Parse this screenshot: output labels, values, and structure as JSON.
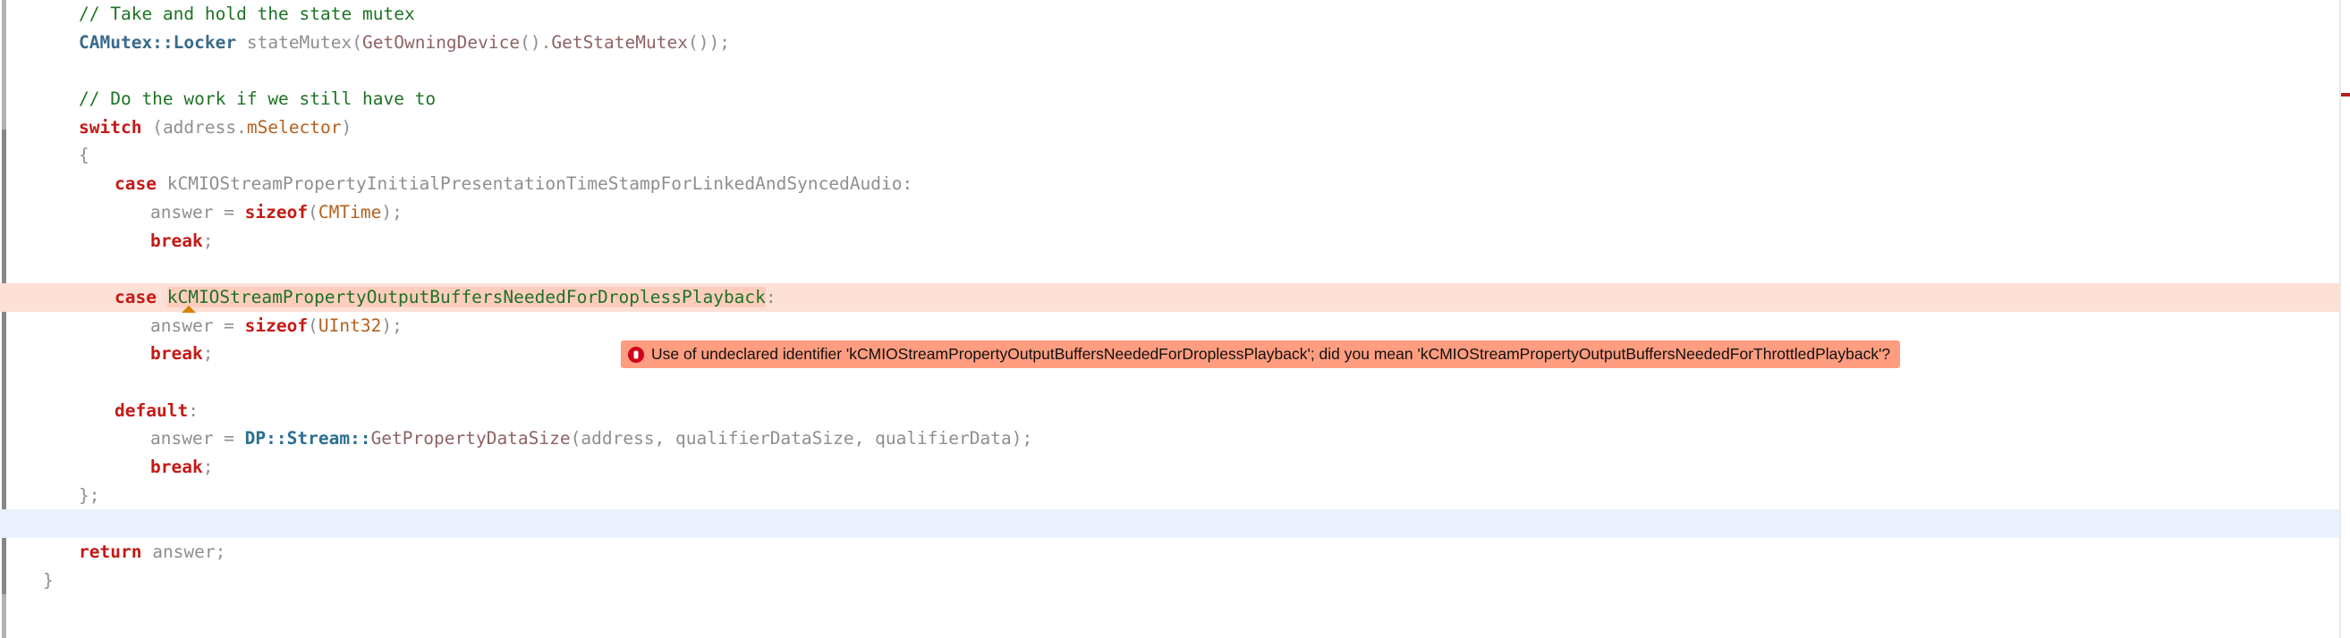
{
  "editor": {
    "language": "C++",
    "colors": {
      "background": "#ffffff",
      "keyword": "#c41a16",
      "comment": "#1d7324",
      "identifier": "#8f8f8f",
      "type": "#3a6a8c",
      "member": "#8e6464",
      "enum_constant": "#b4611f",
      "error_row_background": "#fde0d6",
      "error_token_background": "#ffcdbe",
      "current_line_background": "#eaf1fc",
      "error_bubble_background": "#ff9d80",
      "error_badge": "#d0021b",
      "caret_marker": "#d98000",
      "gutter_bar": "#b3b3b3",
      "gutter_thumb": "#878787",
      "right_rail_mark": "#b31f1f"
    }
  },
  "code": {
    "lines": [
      {
        "id": "line-comment-take-hold",
        "indent": 0,
        "highlight": "none",
        "tokens": [
          {
            "cls": "cmt",
            "text": "// Take and hold the state mutex"
          }
        ]
      },
      {
        "id": "line-camutex-locker",
        "indent": 0,
        "highlight": "none",
        "tokens": [
          {
            "cls": "type",
            "text": "CAMutex::Locker"
          },
          {
            "cls": "plain",
            "text": " "
          },
          {
            "cls": "ident",
            "text": "stateMutex"
          },
          {
            "cls": "punct",
            "text": "("
          },
          {
            "cls": "member",
            "text": "GetOwningDevice"
          },
          {
            "cls": "punct",
            "text": "()."
          },
          {
            "cls": "member",
            "text": "GetStateMutex"
          },
          {
            "cls": "punct",
            "text": "());"
          }
        ]
      },
      {
        "id": "line-blank-1",
        "indent": 0,
        "highlight": "none",
        "tokens": []
      },
      {
        "id": "line-comment-do-work",
        "indent": 0,
        "highlight": "none",
        "tokens": [
          {
            "cls": "cmt",
            "text": "// Do the work if we still have to"
          }
        ]
      },
      {
        "id": "line-switch",
        "indent": 0,
        "highlight": "none",
        "tokens": [
          {
            "cls": "kw",
            "text": "switch"
          },
          {
            "cls": "punct",
            "text": " ("
          },
          {
            "cls": "ident",
            "text": "address."
          },
          {
            "cls": "enumc",
            "text": "mSelector"
          },
          {
            "cls": "punct",
            "text": ")"
          }
        ]
      },
      {
        "id": "line-open-brace",
        "indent": 0,
        "highlight": "none",
        "tokens": [
          {
            "cls": "punct",
            "text": "{"
          }
        ]
      },
      {
        "id": "line-case-initial-presentation",
        "indent": 1,
        "highlight": "none",
        "tokens": [
          {
            "cls": "kw",
            "text": "case"
          },
          {
            "cls": "plain",
            "text": " "
          },
          {
            "cls": "ident",
            "text": "kCMIOStreamPropertyInitialPresentationTimeStampForLinkedAndSyncedAudio"
          },
          {
            "cls": "punct",
            "text": ":"
          }
        ]
      },
      {
        "id": "line-answer-sizeof-cmtime",
        "indent": 2,
        "highlight": "none",
        "tokens": [
          {
            "cls": "ident",
            "text": "answer = "
          },
          {
            "cls": "kw",
            "text": "sizeof"
          },
          {
            "cls": "punct",
            "text": "("
          },
          {
            "cls": "enumc",
            "text": "CMTime"
          },
          {
            "cls": "punct",
            "text": ");"
          }
        ]
      },
      {
        "id": "line-break-1",
        "indent": 2,
        "highlight": "none",
        "tokens": [
          {
            "cls": "kw",
            "text": "break"
          },
          {
            "cls": "punct",
            "text": ";"
          }
        ]
      },
      {
        "id": "line-blank-2",
        "indent": 0,
        "highlight": "none",
        "tokens": []
      },
      {
        "id": "line-case-dropless-playback",
        "indent": 1,
        "highlight": "error",
        "caret": true,
        "tokens": [
          {
            "cls": "kw",
            "text": "case"
          },
          {
            "cls": "plain",
            "text": " "
          },
          {
            "cls": "err-token",
            "text": "kCMIOStreamPropertyOutputBuffersNeededForDroplessPlayback"
          },
          {
            "cls": "punct",
            "text": ":"
          }
        ]
      },
      {
        "id": "line-answer-sizeof-uint32",
        "indent": 2,
        "highlight": "none",
        "tokens": [
          {
            "cls": "ident",
            "text": "answer = "
          },
          {
            "cls": "kw",
            "text": "sizeof"
          },
          {
            "cls": "punct",
            "text": "("
          },
          {
            "cls": "enumc",
            "text": "UInt32"
          },
          {
            "cls": "punct",
            "text": ");"
          }
        ]
      },
      {
        "id": "line-break-2",
        "indent": 2,
        "highlight": "none",
        "tokens": [
          {
            "cls": "kw",
            "text": "break"
          },
          {
            "cls": "punct",
            "text": ";"
          }
        ]
      },
      {
        "id": "line-blank-3",
        "indent": 0,
        "highlight": "none",
        "tokens": []
      },
      {
        "id": "line-default",
        "indent": 1,
        "highlight": "none",
        "tokens": [
          {
            "cls": "kw",
            "text": "default"
          },
          {
            "cls": "punct",
            "text": ":"
          }
        ]
      },
      {
        "id": "line-answer-getpropertydatasize",
        "indent": 2,
        "highlight": "none",
        "tokens": [
          {
            "cls": "ident",
            "text": "answer = "
          },
          {
            "cls": "proj",
            "text": "DP::Stream::"
          },
          {
            "cls": "member",
            "text": "GetPropertyDataSize"
          },
          {
            "cls": "punct",
            "text": "("
          },
          {
            "cls": "ident",
            "text": "address, qualifierDataSize, qualifierData"
          },
          {
            "cls": "punct",
            "text": ");"
          }
        ]
      },
      {
        "id": "line-break-3",
        "indent": 2,
        "highlight": "none",
        "tokens": [
          {
            "cls": "kw",
            "text": "break"
          },
          {
            "cls": "punct",
            "text": ";"
          }
        ]
      },
      {
        "id": "line-close-brace-semi",
        "indent": 0,
        "highlight": "none",
        "tokens": [
          {
            "cls": "punct",
            "text": "};"
          }
        ]
      },
      {
        "id": "line-blank-current",
        "indent": 0,
        "highlight": "current",
        "tokens": []
      },
      {
        "id": "line-return-answer",
        "indent": 0,
        "highlight": "none",
        "tokens": [
          {
            "cls": "kw",
            "text": "return"
          },
          {
            "cls": "plain",
            "text": " "
          },
          {
            "cls": "ident",
            "text": "answer;"
          }
        ]
      },
      {
        "id": "line-function-close-brace",
        "indent": -1,
        "highlight": "none",
        "tokens": [
          {
            "cls": "punct",
            "text": "}"
          }
        ]
      }
    ]
  },
  "diagnostic": {
    "severity": "error",
    "icon": "error-badge-icon",
    "message": "Use of undeclared identifier 'kCMIOStreamPropertyOutputBuffersNeededForDroplessPlayback'; did you mean 'kCMIOStreamPropertyOutputBuffersNeededForThrottledPlayback'?"
  }
}
